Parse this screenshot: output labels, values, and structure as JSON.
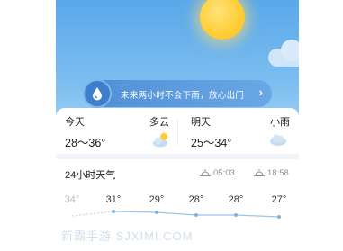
{
  "rain_banner": {
    "text": "未来两小时不会下雨，放心出门",
    "arrow": "›"
  },
  "today": {
    "label": "今天",
    "condition": "多云",
    "temp_range": "28～36°",
    "icon": "partly-cloudy-icon"
  },
  "tomorrow": {
    "label": "明天",
    "condition": "小雨",
    "temp_range": "25～34°",
    "icon": "rain-cloud-icon"
  },
  "hourly": {
    "title": "24小时天气",
    "sunrise": "05:03",
    "sunset": "18:58",
    "temps": [
      "34°",
      "31°",
      "29°",
      "28°",
      "28°",
      "27°"
    ]
  },
  "watermark": "新霸手游 SJXIMI.COM",
  "colors": {
    "banner": "#4f8fd6",
    "sun": "#ffcf3a",
    "line": "#9cc4ec",
    "text": "#222222"
  }
}
